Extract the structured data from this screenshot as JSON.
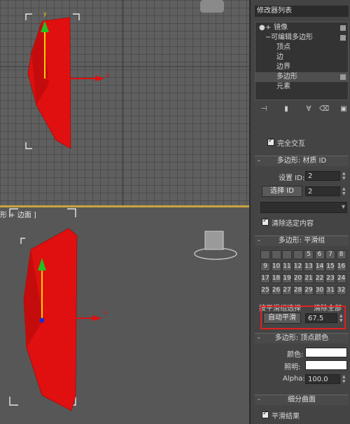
{
  "viewport_top": {},
  "viewport_bottom": {
    "label": "形 + 边面 ]"
  },
  "panel": {
    "modifier_list_label": "修改器列表",
    "stack": [
      "镜像",
      "可编辑多边形",
      "顶点",
      "边",
      "边界",
      "多边形",
      "元素"
    ],
    "selected_stack_item": "多边形",
    "complete_interaction_label": "完全交互",
    "matid_rollout": {
      "title": "多边形: 材质 ID",
      "set_id_label": "设置 ID:",
      "set_id_value": "2",
      "select_id_button": "选择 ID",
      "select_id_value": "2",
      "clear_selection_label": "清除选定内容"
    },
    "smooth_rollout": {
      "title": "多边形: 平滑组",
      "groups": [
        [
          "",
          "",
          "",
          "",
          "5",
          "6",
          "7",
          "8"
        ],
        [
          "9",
          "10",
          "11",
          "12",
          "13",
          "14",
          "15",
          "16"
        ],
        [
          "17",
          "18",
          "19",
          "20",
          "21",
          "22",
          "23",
          "24"
        ],
        [
          "25",
          "26",
          "27",
          "28",
          "29",
          "30",
          "31",
          "32"
        ]
      ],
      "select_by_smooth": "按平滑组选择",
      "clear_all": "清除全部",
      "auto_smooth_button": "自动平滑",
      "auto_smooth_value": "67.5"
    },
    "vertex_color_rollout": {
      "title": "多边形: 顶点颜色",
      "color_label": "颜色:",
      "illum_label": "照明:",
      "alpha_label": "Alpha:",
      "alpha_value": "100.0"
    },
    "subdiv_rollout": {
      "title": "细分曲面",
      "smooth_result_label": "平滑结果"
    }
  },
  "colors": {
    "object_red": "#e01010",
    "highlight_red": "#e02020",
    "active_border": "#c9a341"
  }
}
